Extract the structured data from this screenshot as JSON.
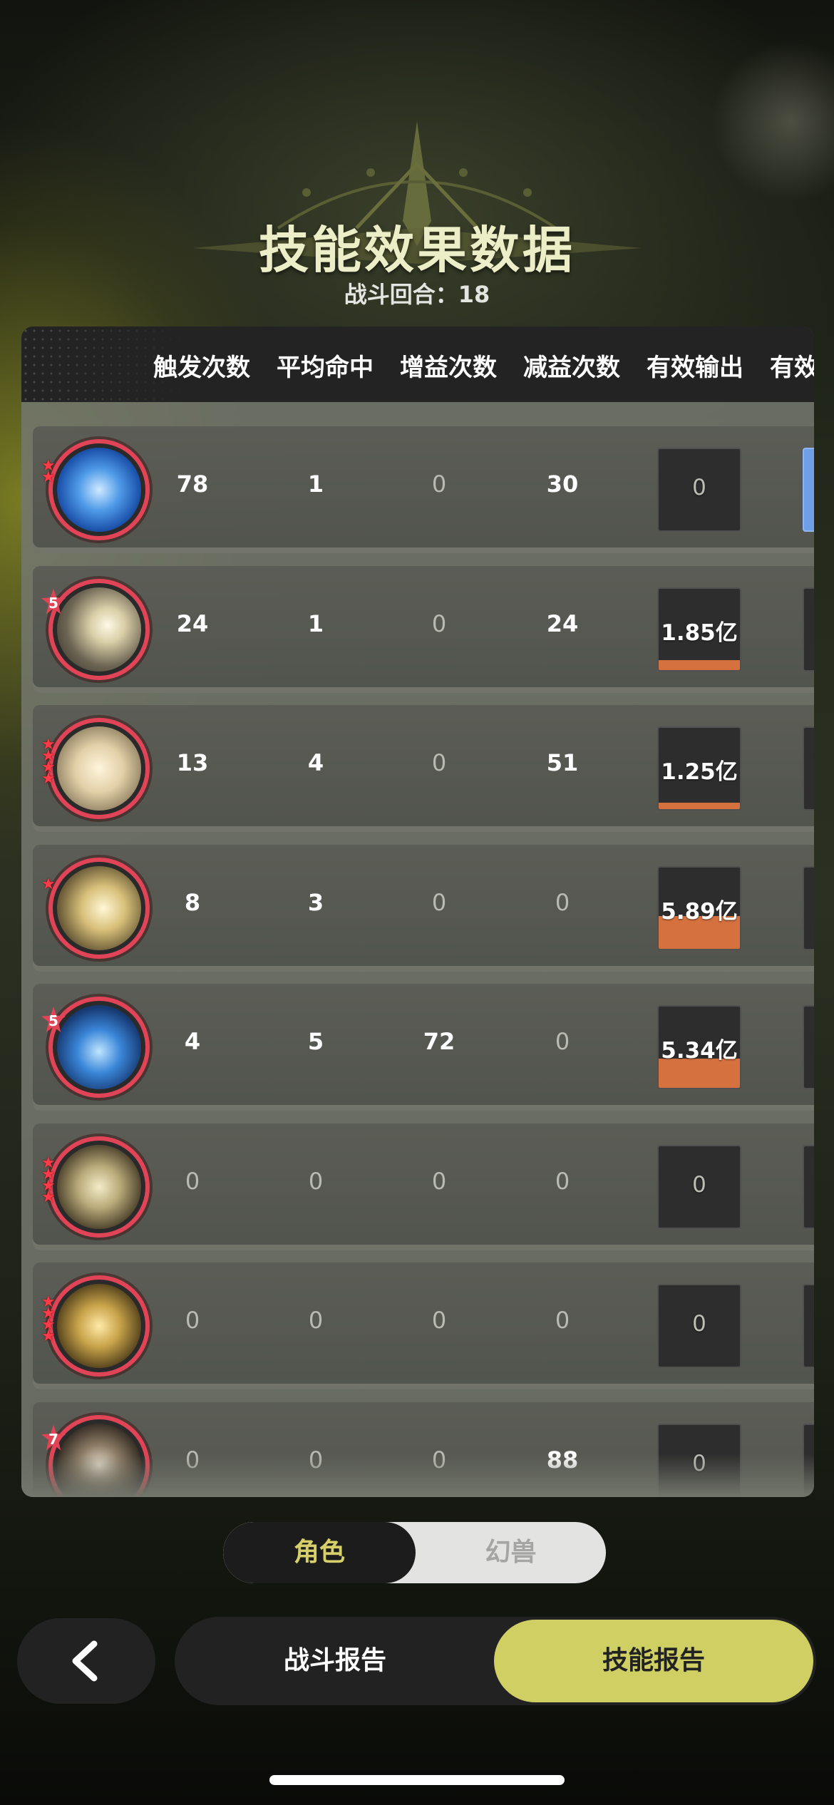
{
  "header": {
    "title": "技能效果数据",
    "round_label": "战斗回合：18"
  },
  "table": {
    "columns": [
      "触发次数",
      "平均命中",
      "增益次数",
      "减益次数",
      "有效输出",
      "有效"
    ],
    "rows": [
      {
        "avatar": "ice-crystal-skill-icon",
        "stars": 2,
        "badge": "",
        "trigger": "78",
        "avg_hit": "1",
        "buff": "0",
        "debuff": "30",
        "output": "0",
        "output_fill": 0,
        "next_highlight": true
      },
      {
        "avatar": "light-slash-skill-icon",
        "stars": 0,
        "badge": "5",
        "trigger": "24",
        "avg_hit": "1",
        "buff": "0",
        "debuff": "24",
        "output": "1.85亿",
        "output_fill": 0.12,
        "next_highlight": false
      },
      {
        "avatar": "golden-emblem-skill-icon",
        "stars": 4,
        "badge": "",
        "trigger": "13",
        "avg_hit": "4",
        "buff": "0",
        "debuff": "51",
        "output": "1.25亿",
        "output_fill": 0.08,
        "next_highlight": false
      },
      {
        "avatar": "wing-strike-skill-icon",
        "stars": 1,
        "badge": "",
        "trigger": "8",
        "avg_hit": "3",
        "buff": "0",
        "debuff": "0",
        "output": "5.89亿",
        "output_fill": 0.4,
        "next_highlight": false
      },
      {
        "avatar": "water-orb-skill-icon",
        "stars": 0,
        "badge": "5",
        "trigger": "4",
        "avg_hit": "5",
        "buff": "72",
        "debuff": "0",
        "output": "5.34亿",
        "output_fill": 0.36,
        "next_highlight": false
      },
      {
        "avatar": "shield-skill-icon",
        "stars": 4,
        "badge": "",
        "trigger": "0",
        "avg_hit": "0",
        "buff": "0",
        "debuff": "0",
        "output": "0",
        "output_fill": 0,
        "next_highlight": false
      },
      {
        "avatar": "golden-relic-skill-icon",
        "stars": 4,
        "badge": "",
        "trigger": "0",
        "avg_hit": "0",
        "buff": "0",
        "debuff": "0",
        "output": "0",
        "output_fill": 0,
        "next_highlight": false
      },
      {
        "avatar": "hourglass-skill-icon",
        "stars": 0,
        "badge": "7",
        "trigger": "0",
        "avg_hit": "0",
        "buff": "0",
        "debuff": "88",
        "output": "0",
        "output_fill": 0,
        "next_highlight": false
      }
    ]
  },
  "toggle": {
    "role_label": "角色",
    "beast_label": "幻兽"
  },
  "footer": {
    "battle_report_label": "战斗报告",
    "skill_report_label": "技能报告"
  },
  "colors": {
    "accent": "#cfcf63",
    "avatar_ring": "#e04456",
    "output_bar": "#d4713f",
    "highlight_blue": "#6f9fe8"
  }
}
